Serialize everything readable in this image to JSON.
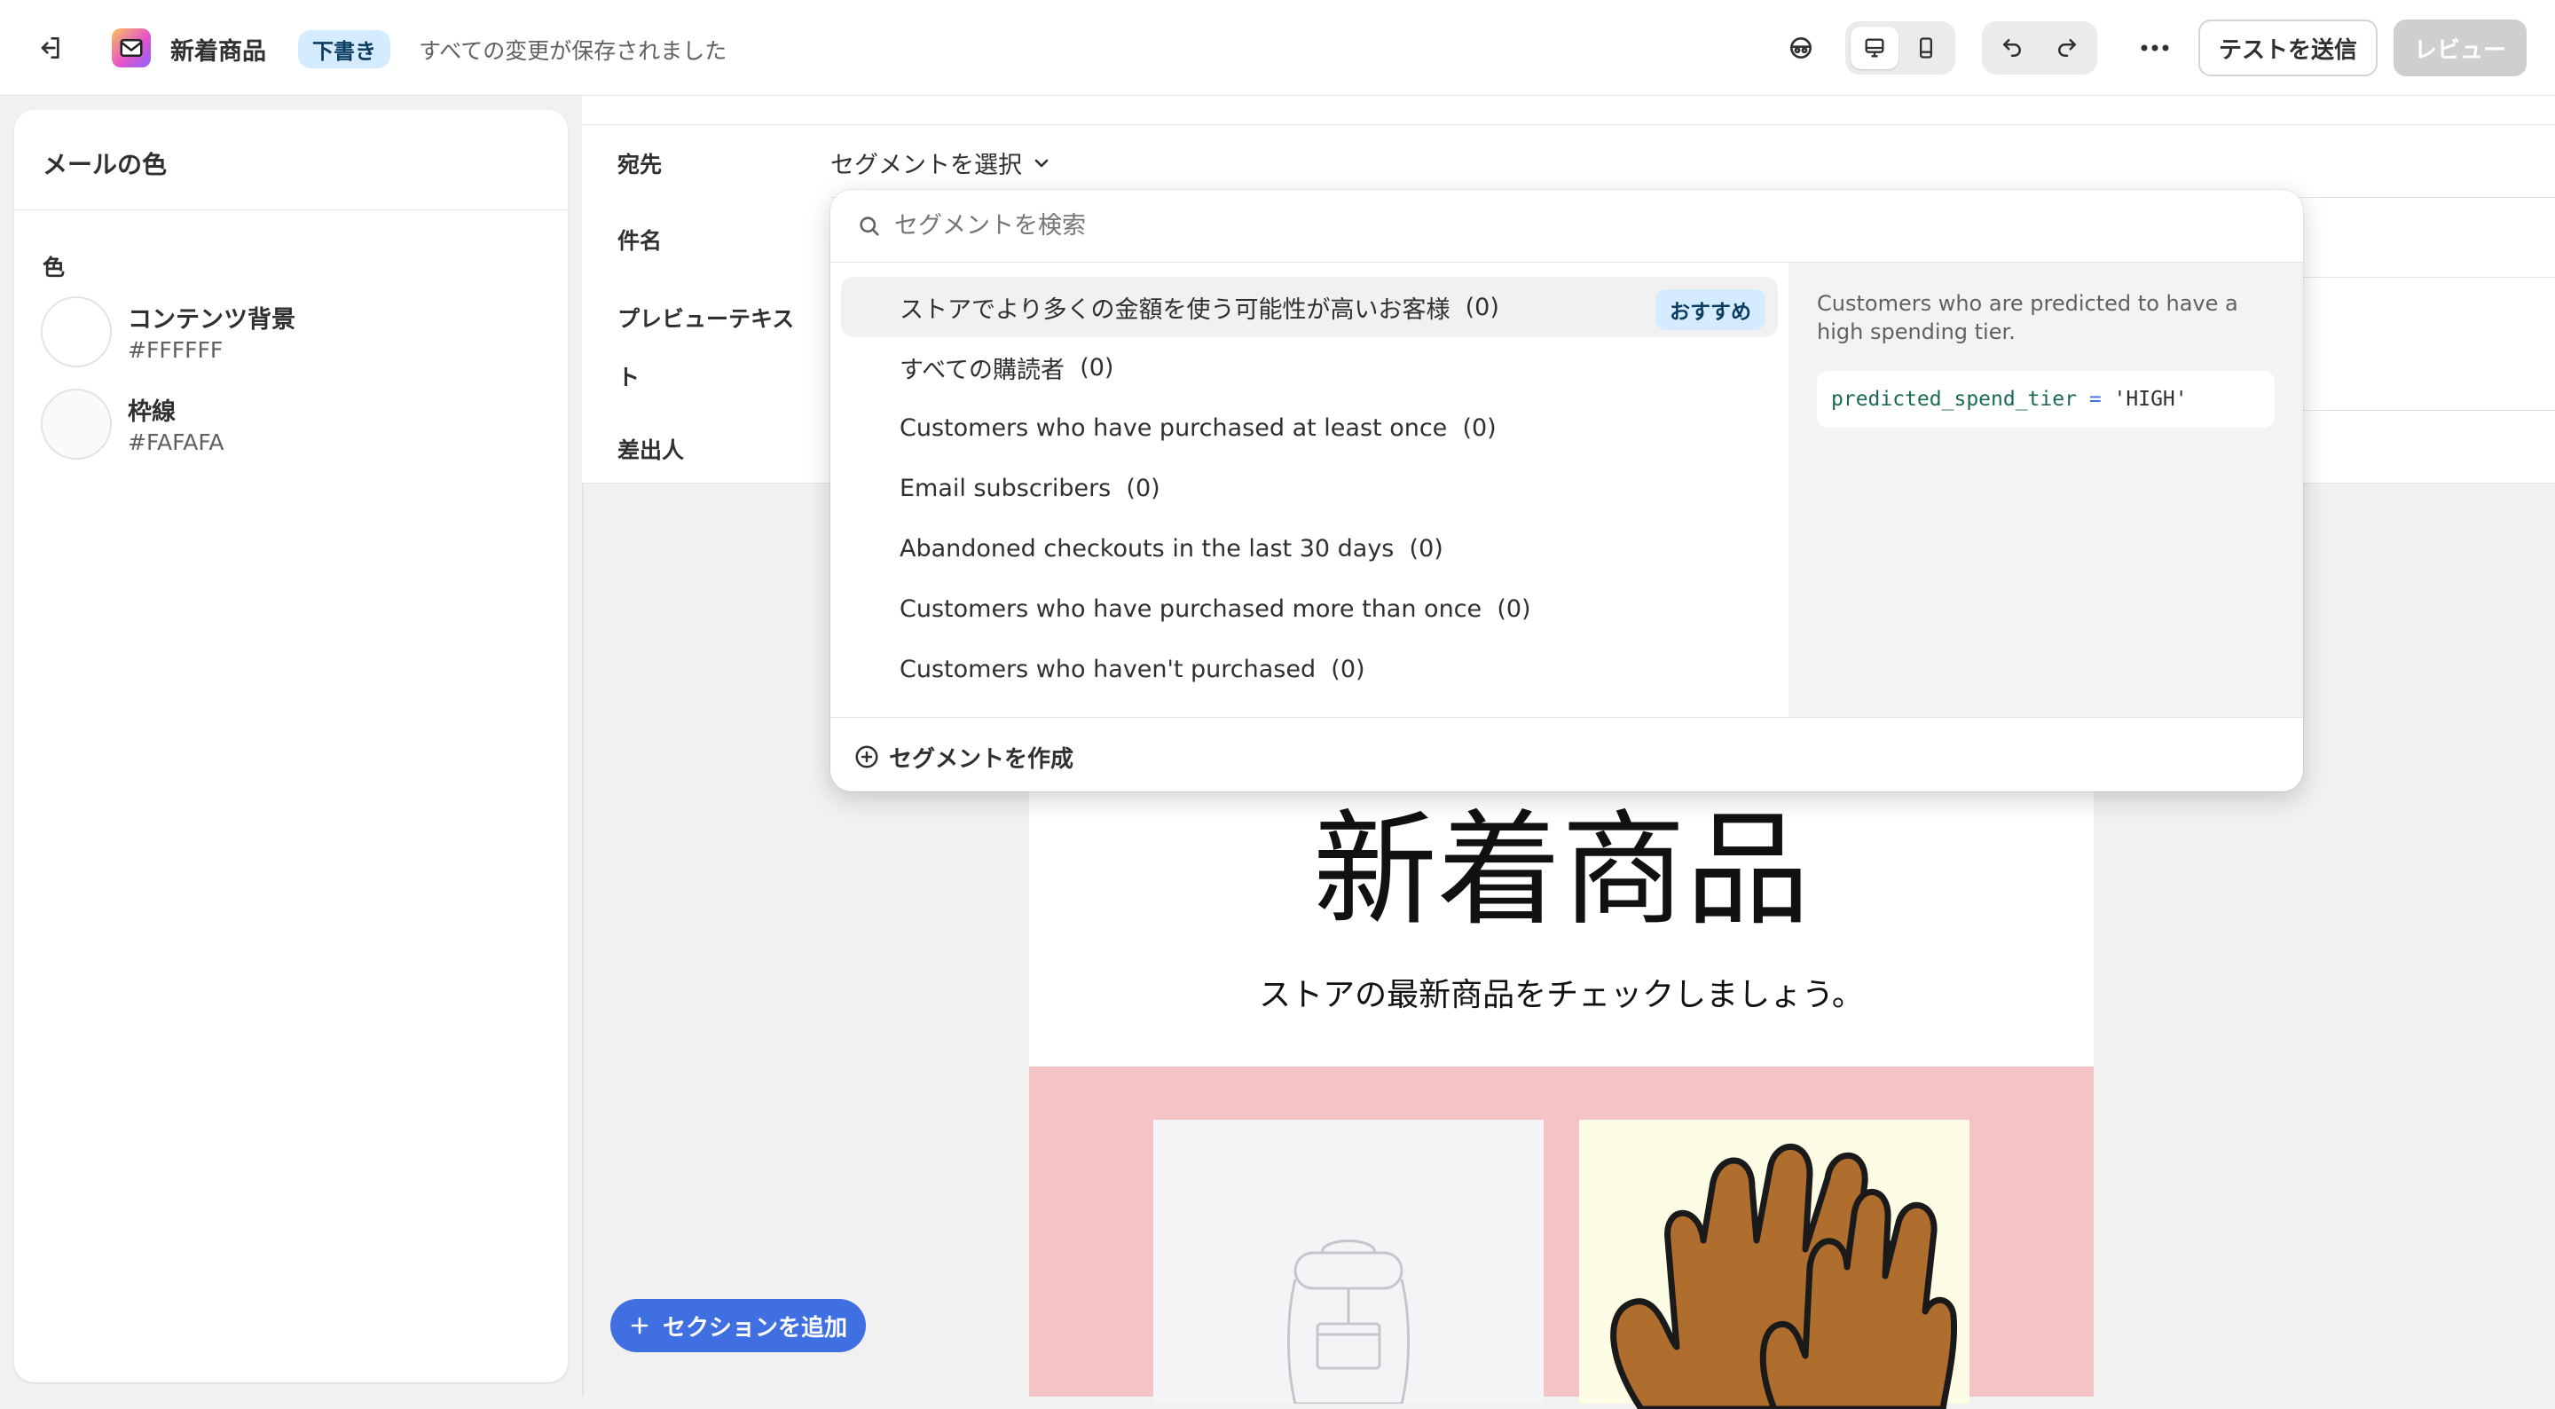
{
  "topbar": {
    "title": "新着商品",
    "status_badge": "下書き",
    "saved_text": "すべての変更が保存されました",
    "send_test_label": "テストを送信",
    "review_label": "レビュー"
  },
  "sidebar": {
    "heading": "メールの色",
    "section_label": "色",
    "colors": [
      {
        "name": "コンテンツ背景",
        "value": "#FFFFFF"
      },
      {
        "name": "枠線",
        "value": "#FAFAFA"
      }
    ]
  },
  "header_fields": {
    "to_label": "宛先",
    "to_value": "セグメントを選択",
    "subject_label": "件名",
    "preview_label_line1": "プレビューテキス",
    "preview_label_line2": "ト",
    "from_label": "差出人"
  },
  "segment_dropdown": {
    "search_placeholder": "セグメントを検索",
    "options": [
      {
        "label": "ストアでより多くの金額を使う可能性が高いお客様",
        "count": "(0)",
        "badge": "おすすめ"
      },
      {
        "label": "すべての購読者",
        "count": "(0)"
      },
      {
        "label": "Customers who have purchased at least once",
        "count": "(0)"
      },
      {
        "label": "Email subscribers",
        "count": "(0)"
      },
      {
        "label": "Abandoned checkouts in the last 30 days",
        "count": "(0)"
      },
      {
        "label": "Customers who have purchased more than once",
        "count": "(0)"
      },
      {
        "label": "Customers who haven't purchased",
        "count": "(0)"
      }
    ],
    "detail_description": "Customers who are predicted to have a high spending tier.",
    "detail_query_field": "predicted_spend_tier",
    "detail_query_op": "=",
    "detail_query_value": "'HIGH'",
    "create_label": "セグメントを作成"
  },
  "email_preview": {
    "heading": "新着商品",
    "subheading": "ストアの最新商品をチェックしましょう。",
    "products_bg": "#f4c4c4"
  },
  "add_section_label": "セクションを追加",
  "colors": {
    "accent": "#3f6fe0",
    "badge_bg": "#d5ebff"
  }
}
